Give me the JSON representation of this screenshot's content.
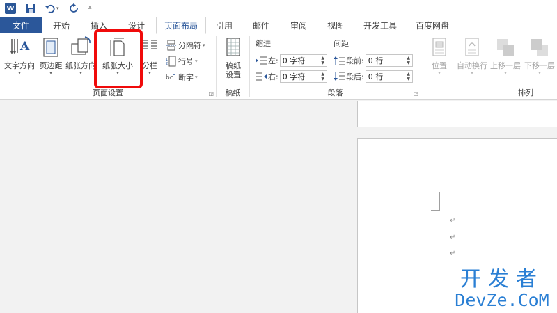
{
  "quick_access": {
    "app_logo": "W",
    "icons": [
      "word-logo",
      "save-icon",
      "undo-icon",
      "redo-icon",
      "customize-icon"
    ]
  },
  "tabs": {
    "file": "文件",
    "items": [
      "开始",
      "插入",
      "设计",
      "页面布局",
      "引用",
      "邮件",
      "审阅",
      "视图",
      "开发工具",
      "百度网盘"
    ],
    "active": "页面布局"
  },
  "ribbon": {
    "page_setup": {
      "label": "页面设置",
      "text_direction": "文字方向",
      "margins": "页边距",
      "orientation": "纸张方向",
      "size": "纸张大小",
      "columns": "分栏",
      "breaks": "分隔符",
      "line_numbers": "行号",
      "hyphenation": "断字"
    },
    "manuscript": {
      "label": "稿纸",
      "button_line1": "稿纸",
      "button_line2": "设置"
    },
    "paragraph": {
      "label": "段落",
      "indent_head": "缩进",
      "spacing_head": "间距",
      "left_label": "左:",
      "left_value": "0 字符",
      "right_label": "右:",
      "right_value": "0 字符",
      "before_label": "段前:",
      "before_value": "0 行",
      "after_label": "段后:",
      "after_value": "0 行"
    },
    "arrange": {
      "label": "排列",
      "position": "位置",
      "wrap_text": "自动换行",
      "bring_forward": "上移一层",
      "send_backward": "下移一层"
    }
  },
  "document": {
    "paragraph_mark": "↵"
  },
  "watermark": {
    "cn": "开发者",
    "en": "DevZe.CoM"
  },
  "colors": {
    "accent": "#2b579a",
    "highlight": "#f00b0b",
    "watermark": "#2a7fd4"
  }
}
